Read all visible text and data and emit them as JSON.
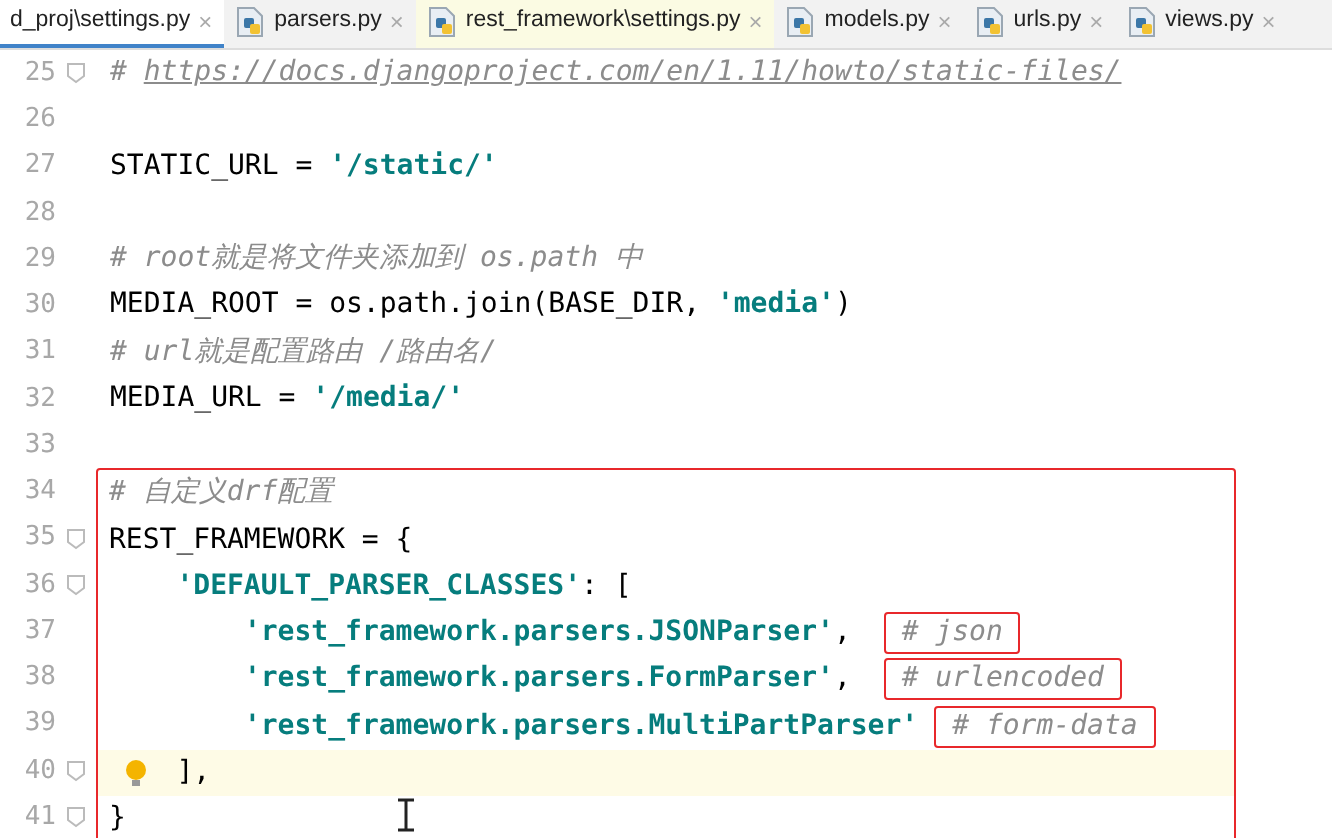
{
  "tabs": [
    {
      "label": "d_proj\\settings.py",
      "close": "×",
      "selected": true,
      "icon": false,
      "library": false
    },
    {
      "label": "parsers.py",
      "close": "×",
      "selected": false,
      "icon": true,
      "library": false
    },
    {
      "label": "rest_framework\\settings.py",
      "close": "×",
      "selected": false,
      "icon": true,
      "library": true
    },
    {
      "label": "models.py",
      "close": "×",
      "selected": false,
      "icon": true,
      "library": false
    },
    {
      "label": "urls.py",
      "close": "×",
      "selected": false,
      "icon": true,
      "library": false
    },
    {
      "label": "views.py",
      "close": "×",
      "selected": false,
      "icon": true,
      "library": false
    }
  ],
  "lines": [
    {
      "number": "25",
      "fold": true,
      "tokens": [
        {
          "kind": "comment",
          "text": "# "
        },
        {
          "kind": "url",
          "text": "https://docs.djangoproject.com/en/1.11/howto/static-files/"
        }
      ]
    },
    {
      "number": "26",
      "fold": false
    },
    {
      "number": "27",
      "fold": false,
      "tokens": [
        {
          "kind": "plain",
          "text": "STATIC_URL = "
        },
        {
          "kind": "string",
          "text": "'/static/'"
        }
      ]
    },
    {
      "number": "28",
      "fold": false
    },
    {
      "number": "29",
      "fold": false,
      "tokens": [
        {
          "kind": "comment",
          "text": "# root就是将文件夹添加到 os.path 中"
        }
      ]
    },
    {
      "number": "30",
      "fold": false,
      "tokens": [
        {
          "kind": "plain",
          "text": "MEDIA_ROOT = os.path.join(BASE_DIR, "
        },
        {
          "kind": "string",
          "text": "'media'"
        },
        {
          "kind": "plain",
          "text": ")"
        }
      ]
    },
    {
      "number": "31",
      "fold": false,
      "tokens": [
        {
          "kind": "comment",
          "text": "# url就是配置路由 /路由名/"
        }
      ]
    },
    {
      "number": "32",
      "fold": false,
      "tokens": [
        {
          "kind": "plain",
          "text": "MEDIA_URL = "
        },
        {
          "kind": "string",
          "text": "'/media/'"
        }
      ]
    },
    {
      "number": "33",
      "fold": false
    }
  ],
  "annotated_block": {
    "lines": [
      {
        "number": "34",
        "fold": false,
        "current": false,
        "bulb": false,
        "tokens": [
          {
            "kind": "comment",
            "text": "# 自定义drf配置"
          }
        ]
      },
      {
        "number": "35",
        "fold": true,
        "current": false,
        "bulb": false,
        "tokens": [
          {
            "kind": "plain",
            "text": "REST_FRAMEWORK = {"
          }
        ]
      },
      {
        "number": "36",
        "fold": true,
        "current": false,
        "bulb": false,
        "tokens": [
          {
            "kind": "string",
            "text": "    'DEFAULT_PARSER_CLASSES'"
          },
          {
            "kind": "plain",
            "text": ": ["
          }
        ]
      },
      {
        "number": "37",
        "fold": false,
        "current": false,
        "bulb": false,
        "tokens": [
          {
            "kind": "string",
            "text": "        'rest_framework.parsers.JSONParser'"
          },
          {
            "kind": "plain",
            "text": ", "
          },
          {
            "kind": "comment",
            "text": "# json",
            "boxed": true
          }
        ]
      },
      {
        "number": "38",
        "fold": false,
        "current": false,
        "bulb": false,
        "tokens": [
          {
            "kind": "string",
            "text": "        'rest_framework.parsers.FormParser'"
          },
          {
            "kind": "plain",
            "text": ", "
          },
          {
            "kind": "comment",
            "text": "# urlencoded",
            "boxed": true
          }
        ]
      },
      {
        "number": "39",
        "fold": false,
        "current": false,
        "bulb": false,
        "tokens": [
          {
            "kind": "string",
            "text": "        'rest_framework.parsers.MultiPartParser'"
          },
          {
            "kind": "comment",
            "text": "# form-data",
            "boxed": true
          }
        ]
      },
      {
        "number": "40",
        "fold": true,
        "current": true,
        "bulb": true,
        "tokens": [
          {
            "kind": "plain",
            "text": "    ],"
          }
        ]
      },
      {
        "number": "41",
        "fold": true,
        "current": false,
        "bulb": false,
        "tokens": [
          {
            "kind": "plain",
            "text": "}"
          }
        ]
      }
    ]
  }
}
